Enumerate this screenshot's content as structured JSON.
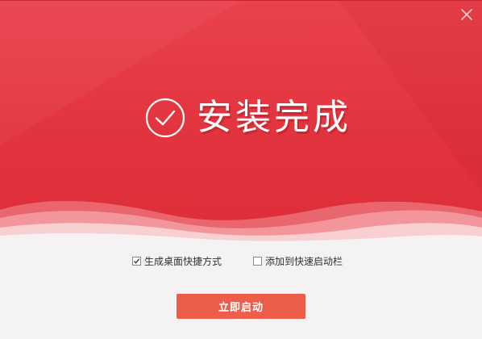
{
  "window": {
    "close_icon": "close-icon"
  },
  "hero": {
    "status_icon": "check-circle-icon",
    "title": "安装完成"
  },
  "options": [
    {
      "label": "生成桌面快捷方式",
      "checked": true
    },
    {
      "label": "添加到快速启动栏",
      "checked": false
    }
  ],
  "launch_button": {
    "label": "立即启动"
  },
  "colors": {
    "brand_red": "#e2343f",
    "button": "#ec5d4c",
    "panel": "#f4f2f2",
    "text": "#333333"
  }
}
